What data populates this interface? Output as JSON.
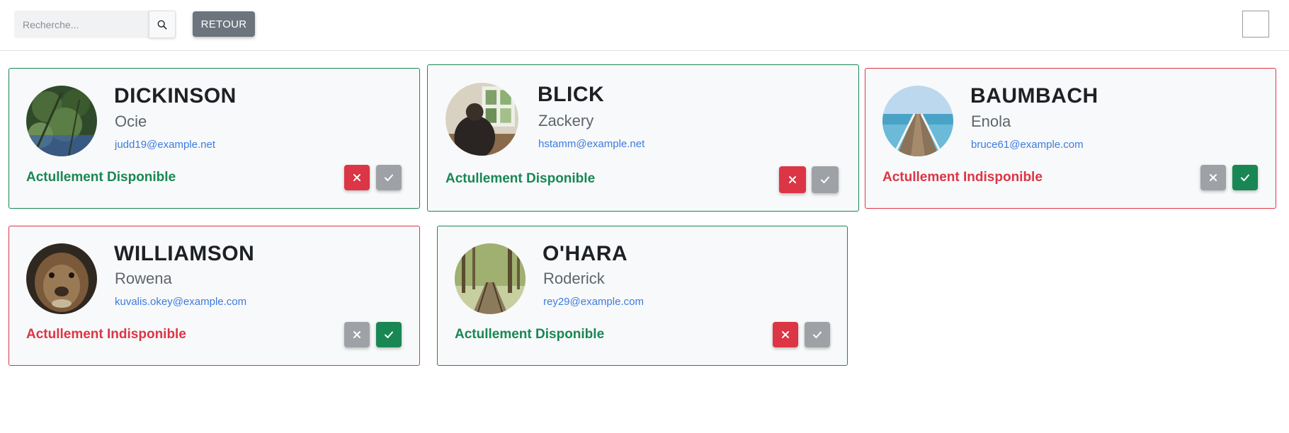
{
  "header": {
    "search_placeholder": "Recherche...",
    "retour_label": "RETOUR"
  },
  "cards": [
    {
      "last_name": "DICKINSON",
      "first_name": "Ocie",
      "email": "judd19@example.net",
      "status": "Actullement Disponible",
      "available": true
    },
    {
      "last_name": "BLICK",
      "first_name": "Zackery",
      "email": "hstamm@example.net",
      "status": "Actullement Disponible",
      "available": true
    },
    {
      "last_name": "BAUMBACH",
      "first_name": "Enola",
      "email": "bruce61@example.com",
      "status": "Actullement Indisponible",
      "available": false
    },
    {
      "last_name": "WILLIAMSON",
      "first_name": "Rowena",
      "email": "kuvalis.okey@example.com",
      "status": "Actullement Indisponible",
      "available": false
    },
    {
      "last_name": "O'HARA",
      "first_name": "Roderick",
      "email": "rey29@example.com",
      "status": "Actullement Disponible",
      "available": true
    }
  ],
  "colors": {
    "available": "#198754",
    "unavailable": "#dc3545",
    "email": "#3d7be0",
    "neutral_button": "#9ea2a7"
  }
}
